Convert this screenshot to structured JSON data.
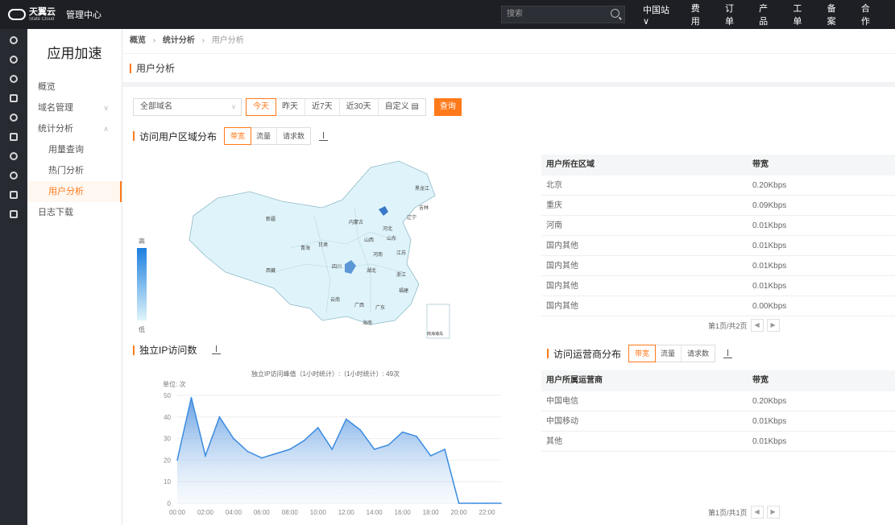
{
  "topbar": {
    "logo_cn": "天翼云",
    "logo_en": "State Cloud",
    "mgmt": "管理中心",
    "search_placeholder": "搜索",
    "nav": [
      "中国站∨",
      "费用",
      "订单",
      "产品",
      "工单",
      "备案",
      "合作"
    ]
  },
  "sidebar": {
    "title": "应用加速",
    "items": [
      {
        "label": "概览"
      },
      {
        "label": "域名管理",
        "chevron": "∨"
      },
      {
        "label": "统计分析",
        "chevron": "∧"
      },
      {
        "label": "用量查询"
      },
      {
        "label": "热门分析"
      },
      {
        "label": "用户分析"
      },
      {
        "label": "日志下载"
      }
    ]
  },
  "breadcrumb": {
    "home": "概览",
    "sep": "›",
    "mid": "统计分析",
    "current": "用户分析"
  },
  "page_title": "用户分析",
  "filter": {
    "domain_select": "全部域名",
    "ranges": [
      "今天",
      "昨天",
      "近7天",
      "近30天",
      "自定义 ▤"
    ],
    "query": "查询"
  },
  "region": {
    "title": "访问用户区域分布",
    "metrics": [
      "带宽",
      "流量",
      "请求数"
    ],
    "legend_high": "高",
    "legend_low": "低",
    "table_headers": [
      "用户所在区域",
      "带宽"
    ],
    "rows": [
      [
        "北京",
        "0.20Kbps"
      ],
      [
        "重庆",
        "0.09Kbps"
      ],
      [
        "河南",
        "0.01Kbps"
      ],
      [
        "国内其他",
        "0.01Kbps"
      ],
      [
        "国内其他",
        "0.01Kbps"
      ],
      [
        "国内其他",
        "0.01Kbps"
      ],
      [
        "国内其他",
        "0.00Kbps"
      ]
    ],
    "pager": "第1页/共2页"
  },
  "map_labels": {
    "heilongjiang": "黑龙江",
    "jilin": "吉林",
    "liaoning": "辽宁",
    "neimenggu": "内蒙古",
    "xinjiang": "新疆",
    "xizang": "西藏",
    "qinghai": "青海",
    "gansu": "甘肃",
    "sichuan": "四川",
    "yunnan": "云南",
    "guangxi": "广西",
    "guangdong": "广东",
    "hubei": "湖北",
    "henan": "河南",
    "shanxi": "山西",
    "hebei": "河北",
    "shandong": "山东",
    "jiangsu": "江苏",
    "zhejiang": "浙江",
    "fujian": "福建",
    "hainan": "海南",
    "nanhai": "南海诸岛"
  },
  "ip": {
    "title": "独立IP访问数",
    "peak_text": "独立IP访问峰值（1小时统计）:（1小时统计）: 49次",
    "unit": "单位: 次"
  },
  "isp": {
    "title": "访问运营商分布",
    "metrics": [
      "带宽",
      "流量",
      "请求数"
    ],
    "table_headers": [
      "用户所属运营商",
      "带宽"
    ],
    "rows": [
      [
        "中国电信",
        "0.20Kbps"
      ],
      [
        "中国移动",
        "0.01Kbps"
      ],
      [
        "其他",
        "0.01Kbps"
      ]
    ],
    "pager": "第1页/共1页"
  },
  "colors": {
    "accent": "#ff7a1a",
    "map_fill": "#dff4fa",
    "map_high": "#1c7fe0",
    "area_line": "#3b8be0"
  },
  "chart_data": {
    "type": "area",
    "x": [
      "00:00",
      "01:00",
      "02:00",
      "03:00",
      "04:00",
      "05:00",
      "06:00",
      "07:00",
      "08:00",
      "09:00",
      "10:00",
      "11:00",
      "12:00",
      "13:00",
      "14:00",
      "15:00",
      "16:00",
      "17:00",
      "18:00",
      "19:00",
      "20:00",
      "21:00",
      "22:00",
      "23:00"
    ],
    "xticks": [
      "00:00",
      "02:00",
      "04:00",
      "06:00",
      "08:00",
      "10:00",
      "12:00",
      "14:00",
      "16:00",
      "18:00",
      "20:00",
      "22:00"
    ],
    "values": [
      20,
      49,
      22,
      40,
      30,
      24,
      21,
      23,
      25,
      29,
      35,
      25,
      39,
      34,
      25,
      27,
      33,
      31,
      22,
      25,
      0,
      0,
      0,
      0
    ],
    "ylim": [
      0,
      50
    ],
    "yticks": [
      0,
      10,
      20,
      30,
      40,
      50
    ],
    "ylabel": "单位: 次",
    "title": "独立IP访问峰值（1小时统计）:（1小时统计）: 49次"
  }
}
